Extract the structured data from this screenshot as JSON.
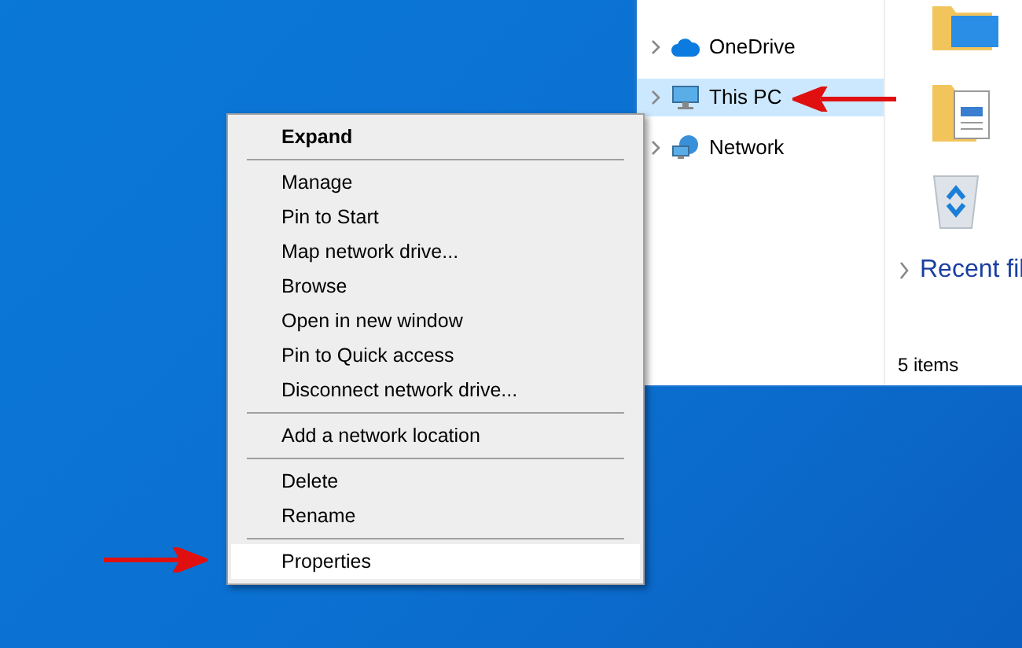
{
  "explorer": {
    "nav_items": [
      {
        "label": "OneDrive",
        "kind": "cloud",
        "selected": false
      },
      {
        "label": "This PC",
        "kind": "computer",
        "selected": true
      },
      {
        "label": "Network",
        "kind": "network",
        "selected": false
      }
    ],
    "content": {
      "section_header": "Recent fil"
    },
    "status_bar": "5 items"
  },
  "context_menu": {
    "items": [
      {
        "kind": "item",
        "label": "Expand",
        "default": true,
        "selected": false
      },
      {
        "kind": "separator"
      },
      {
        "kind": "item",
        "label": "Manage",
        "default": false,
        "selected": false
      },
      {
        "kind": "item",
        "label": "Pin to Start",
        "default": false,
        "selected": false
      },
      {
        "kind": "item",
        "label": "Map network drive...",
        "default": false,
        "selected": false
      },
      {
        "kind": "item",
        "label": "Browse",
        "default": false,
        "selected": false
      },
      {
        "kind": "item",
        "label": "Open in new window",
        "default": false,
        "selected": false
      },
      {
        "kind": "item",
        "label": "Pin to Quick access",
        "default": false,
        "selected": false
      },
      {
        "kind": "item",
        "label": "Disconnect network drive...",
        "default": false,
        "selected": false
      },
      {
        "kind": "separator"
      },
      {
        "kind": "item",
        "label": "Add a network location",
        "default": false,
        "selected": false
      },
      {
        "kind": "separator"
      },
      {
        "kind": "item",
        "label": "Delete",
        "default": false,
        "selected": false
      },
      {
        "kind": "item",
        "label": "Rename",
        "default": false,
        "selected": false
      },
      {
        "kind": "separator"
      },
      {
        "kind": "item",
        "label": "Properties",
        "default": false,
        "selected": true
      }
    ]
  }
}
